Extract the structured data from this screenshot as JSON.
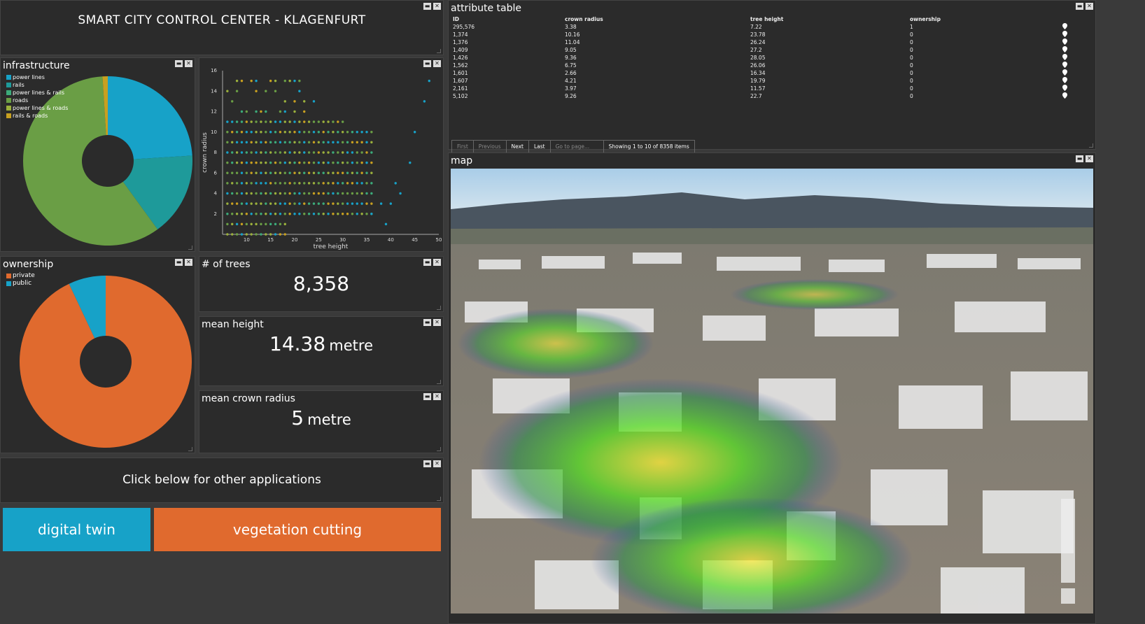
{
  "header": {
    "title": "SMART CITY CONTROL CENTER - KLAGENFURT"
  },
  "infrastructure": {
    "title": "infrastructure",
    "legend": [
      {
        "label": "power lines",
        "color": "#17a2c8"
      },
      {
        "label": "rails",
        "color": "#1e9a9a"
      },
      {
        "label": "power lines & rails",
        "color": "#3cab7a"
      },
      {
        "label": "roads",
        "color": "#6a9e45"
      },
      {
        "label": "power lines & roads",
        "color": "#9bb03c"
      },
      {
        "label": "rails & roads",
        "color": "#c8a020"
      }
    ],
    "chart_data": {
      "type": "pie",
      "labels": [
        "power lines",
        "rails",
        "power lines & rails",
        "roads",
        "power lines & roads",
        "rails & roads"
      ],
      "values": [
        24,
        16,
        0,
        59,
        0,
        1
      ],
      "colors": [
        "#17a2c8",
        "#1e9a9a",
        "#3cab7a",
        "#6a9e45",
        "#9bb03c",
        "#c8a020"
      ]
    }
  },
  "scatter": {
    "xlabel": "tree height",
    "ylabel": "crown radius",
    "xticks": [
      "10",
      "15",
      "20",
      "25",
      "30",
      "35",
      "40",
      "45",
      "50"
    ],
    "yticks": [
      "2",
      "4",
      "6",
      "8",
      "10",
      "12",
      "14",
      "16"
    ],
    "chart_data": {
      "type": "scatter",
      "xlabel": "tree height",
      "ylabel": "crown radius",
      "xlim": [
        5,
        50
      ],
      "ylim": [
        0,
        16
      ],
      "points": "dense integer grid: tree height 6-40, crown radius 0-15 (see attribute table)"
    }
  },
  "ownership": {
    "title": "ownership",
    "legend": [
      {
        "label": "private",
        "color": "#e06a2e"
      },
      {
        "label": "public",
        "color": "#17a2c8"
      }
    ],
    "chart_data": {
      "type": "pie",
      "labels": [
        "private",
        "public"
      ],
      "values": [
        93,
        7
      ],
      "colors": [
        "#e06a2e",
        "#17a2c8"
      ]
    }
  },
  "kpi": {
    "trees_title": "# of trees",
    "trees_value": "8,358",
    "height_title": "mean height",
    "height_value": "14.38",
    "height_unit": "metre",
    "crown_title": "mean crown radius",
    "crown_value": "5",
    "crown_unit": "metre"
  },
  "apps": {
    "caption": "Click below for other applications",
    "digital_twin": "digital twin",
    "vegetation": "vegetation cutting"
  },
  "attribute_table": {
    "title": "attribute table",
    "columns": [
      "ID",
      "crown radius",
      "tree height",
      "ownership"
    ],
    "rows": [
      [
        "295,576",
        "3.38",
        "7.22",
        "1"
      ],
      [
        "1,374",
        "10.16",
        "23.78",
        "0"
      ],
      [
        "1,376",
        "11.04",
        "26.24",
        "0"
      ],
      [
        "1,409",
        "9.05",
        "27.2",
        "0"
      ],
      [
        "1,426",
        "9.36",
        "28.05",
        "0"
      ],
      [
        "1,562",
        "6.75",
        "26.06",
        "0"
      ],
      [
        "1,601",
        "2.66",
        "16.34",
        "0"
      ],
      [
        "1,607",
        "4.21",
        "19.79",
        "0"
      ],
      [
        "2,161",
        "3.97",
        "11.57",
        "0"
      ],
      [
        "5,102",
        "9.26",
        "22.7",
        "0"
      ]
    ],
    "pager": {
      "first": "First",
      "previous": "Previous",
      "next": "Next",
      "last": "Last",
      "goto_placeholder": "Go to page...",
      "showing": "Showing 1 to 10 of 8358 items"
    }
  },
  "map": {
    "title": "map"
  },
  "icons": {
    "minimize": "minimize-icon",
    "close": "close-icon",
    "location": "location-pin-icon"
  }
}
